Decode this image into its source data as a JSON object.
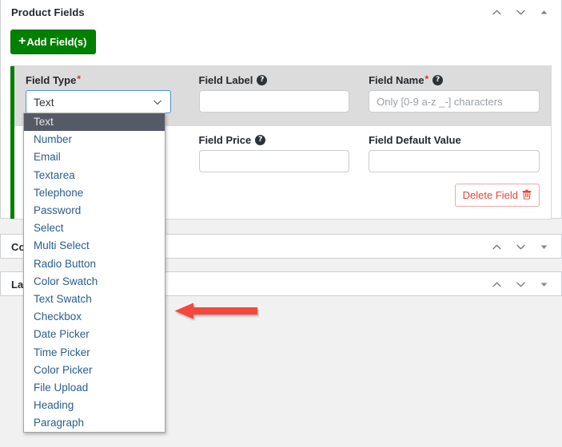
{
  "panels": [
    {
      "id": "product-fields",
      "title": "Product Fields",
      "state": "expanded",
      "toggle_icon": "triangle-up-icon"
    },
    {
      "id": "conditional",
      "title": "Cor",
      "state": "collapsed",
      "toggle_icon": "triangle-down-icon"
    },
    {
      "id": "labels",
      "title": "Lab",
      "state": "collapsed",
      "toggle_icon": "triangle-down-icon"
    }
  ],
  "handle_icons": {
    "move_up": "chevron-up-icon",
    "move_down": "chevron-down-icon"
  },
  "toolbar": {
    "add_field_label": "Add Field(s)",
    "add_field_plus": "+"
  },
  "field_card": {
    "accent_color": "#008000",
    "labels": {
      "field_type": "Field Type",
      "field_label": "Field Label",
      "field_name": "Field Name",
      "field_price": "Field Price",
      "field_default_value": "Field Default Value",
      "required_marker": "*",
      "help_glyph": "?"
    },
    "values": {
      "field_type_selected": "Text",
      "field_label_value": "",
      "field_label_placeholder": "",
      "field_name_value": "",
      "field_name_placeholder": "Only [0-9 a-z _-] characters",
      "field_price_value": "",
      "field_price_placeholder": "",
      "field_default_value": "",
      "field_default_placeholder": ""
    },
    "delete_button": {
      "label": "Delete Field",
      "icon": "trash-icon",
      "glyph": "Ὕ1",
      "color": "#ea4335"
    }
  },
  "dropdown": {
    "open": true,
    "selected": "Text",
    "options": [
      "Text",
      "Number",
      "Email",
      "Textarea",
      "Telephone",
      "Password",
      "Select",
      "Multi Select",
      "Radio Button",
      "Color Swatch",
      "Text Swatch",
      "Checkbox",
      "Date Picker",
      "Time Picker",
      "Color Picker",
      "File Upload",
      "Heading",
      "Paragraph"
    ],
    "option_color": "#2a5d8f",
    "highlight_bg": "#555a66"
  },
  "annotation": {
    "type": "arrow",
    "direction": "left",
    "color": "#f4463c"
  }
}
